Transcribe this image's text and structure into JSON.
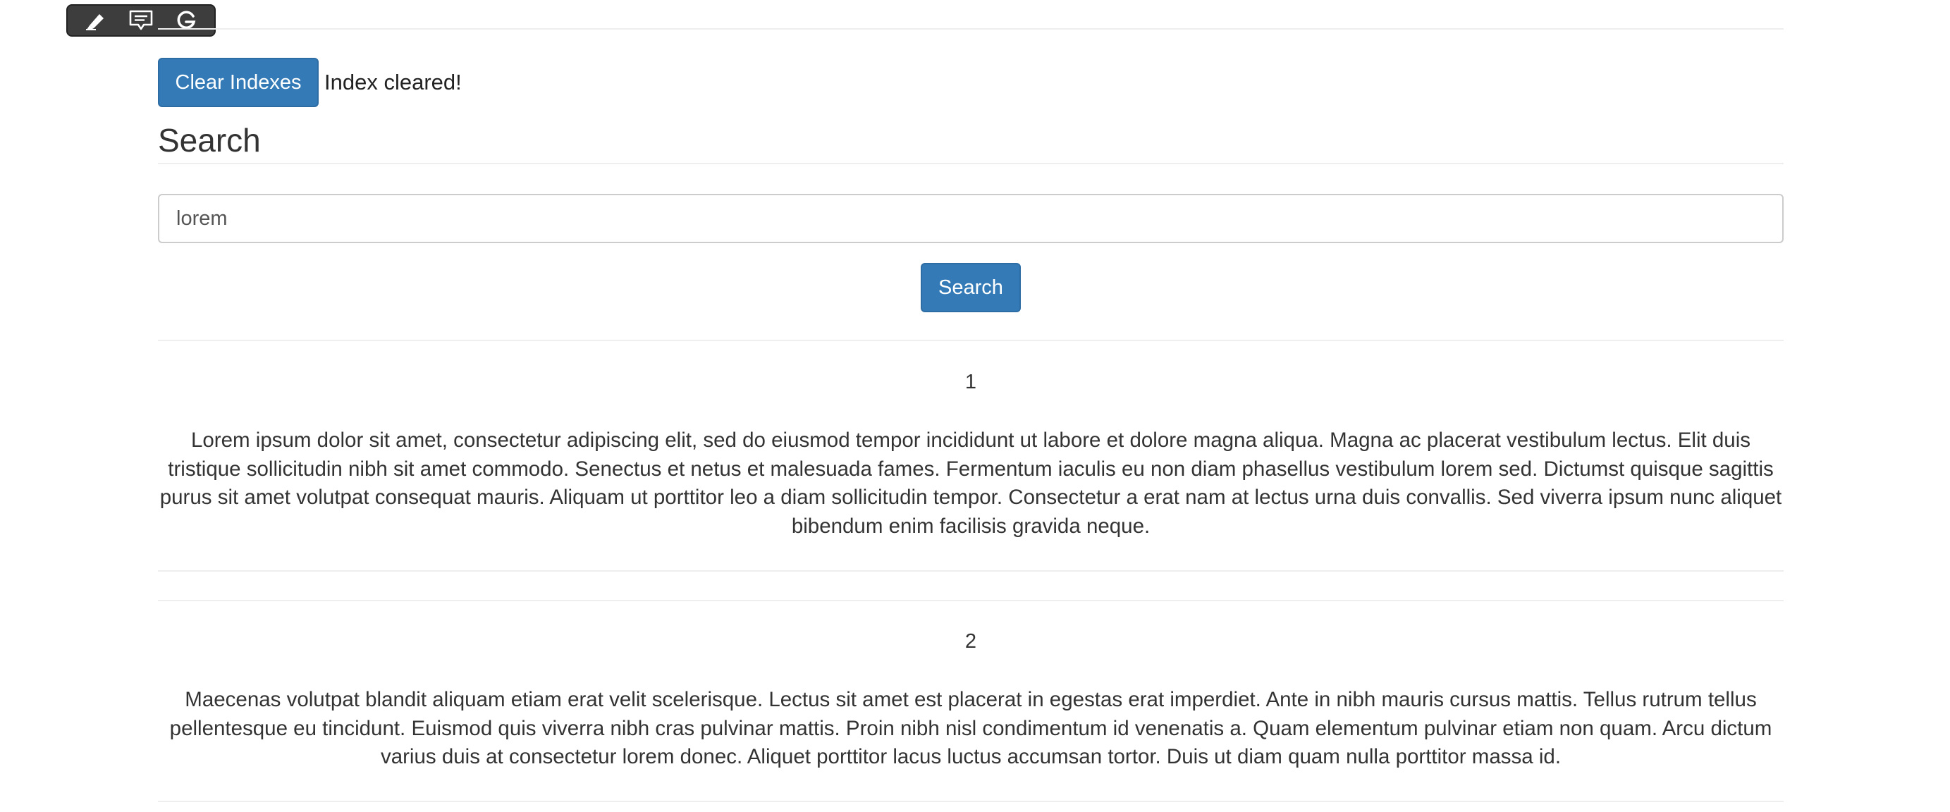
{
  "toolbar": {
    "icons": [
      "highlighter-icon",
      "comment-icon",
      "google-icon"
    ]
  },
  "clear": {
    "button_label": "Clear Indexes",
    "status": "Index cleared!"
  },
  "search": {
    "heading": "Search",
    "input_value": "lorem",
    "button_label": "Search"
  },
  "results": [
    {
      "number": "1",
      "text": "Lorem ipsum dolor sit amet, consectetur adipiscing elit, sed do eiusmod tempor incididunt ut labore et dolore magna aliqua. Magna ac placerat vestibulum lectus. Elit duis tristique sollicitudin nibh sit amet commodo. Senectus et netus et malesuada fames. Fermentum iaculis eu non diam phasellus vestibulum lorem sed. Dictumst quisque sagittis purus sit amet volutpat consequat mauris. Aliquam ut porttitor leo a diam sollicitudin tempor. Consectetur a erat nam at lectus urna duis convallis. Sed viverra ipsum nunc aliquet bibendum enim facilisis gravida neque."
    },
    {
      "number": "2",
      "text": "Maecenas volutpat blandit aliquam etiam erat velit scelerisque. Lectus sit amet est placerat in egestas erat imperdiet. Ante in nibh mauris cursus mattis. Tellus rutrum tellus pellentesque eu tincidunt. Euismod quis viverra nibh cras pulvinar mattis. Proin nibh nisl condimentum id venenatis a. Quam elementum pulvinar etiam non quam. Arcu dictum varius duis at consectetur lorem donec. Aliquet porttitor lacus luctus accumsan tortor. Duis ut diam quam nulla porttitor massa id."
    }
  ],
  "colors": {
    "primary": "#337ab7",
    "primary_border": "#2e6da4",
    "rule": "#eeeeee",
    "toolbar_bg": "#3d3d3d"
  }
}
